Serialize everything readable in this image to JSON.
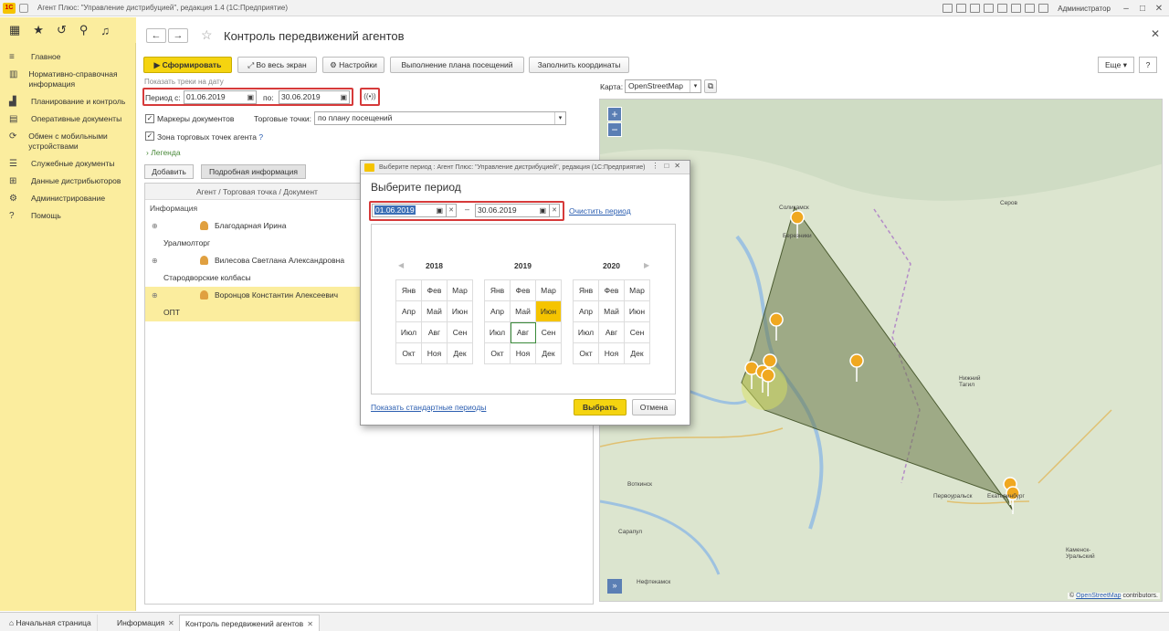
{
  "window": {
    "title": "Агент Плюс: \"Управление дистрибуцией\", редакция 1.4 (1С:Предприятие)",
    "user": "Администратор"
  },
  "sidebar": {
    "items": [
      {
        "label": "Главное",
        "icon": "menu-icon"
      },
      {
        "label": "Нормативно-справочная информация",
        "icon": "grid-icon"
      },
      {
        "label": "Планирование и контроль",
        "icon": "chart-icon"
      },
      {
        "label": "Оперативные документы",
        "icon": "document-icon"
      },
      {
        "label": "Обмен с мобильными устройствами",
        "icon": "sync-icon"
      },
      {
        "label": "Служебные документы",
        "icon": "list-icon"
      },
      {
        "label": "Данные дистрибьюторов",
        "icon": "table-icon"
      },
      {
        "label": "Администрирование",
        "icon": "gear-icon"
      },
      {
        "label": "Помощь",
        "icon": "help-icon"
      }
    ]
  },
  "page": {
    "title": "Контроль передвижений агентов"
  },
  "toolbar": {
    "generate": "Сформировать",
    "fullscreen": "Во весь экран",
    "settings": "Настройки",
    "plan": "Выполнение плана посещений",
    "fill_coords": "Заполнить координаты",
    "more": "Еще",
    "help": "?"
  },
  "filters": {
    "hint": "Показать треки на дату",
    "period_from_label": "Период с:",
    "period_from": "01.06.2019",
    "period_to_label": "по:",
    "period_to": "30.06.2019",
    "doc_markers": "Маркеры документов",
    "trade_points_label": "Торговые точки:",
    "trade_points_value": "по плану посещений",
    "zone_label": "Зона торговых точек агента",
    "zone_help": "?",
    "legend": "Легенда"
  },
  "tabs": {
    "add": "Добавить",
    "details": "Подробная информация"
  },
  "grid": {
    "header": "Агент / Торговая точка / Документ",
    "subheader": "Информация",
    "rows": [
      {
        "agent": "Благодарная Ирина",
        "org": "Уралмолторг"
      },
      {
        "agent": "Вилесова Светлана Александровна",
        "org": "Стародворские колбасы"
      },
      {
        "agent": "Воронцов Константин Алексеевич",
        "org": "ОПТ"
      }
    ]
  },
  "map": {
    "label": "Карта:",
    "provider": "OpenStreetMap",
    "zoom_in": "+",
    "zoom_out": "−",
    "expand": "»",
    "attribution_link": "OpenStreetMap",
    "attribution_text": "contributors.",
    "attribution_prefix": "©",
    "cities": [
      {
        "name": "Соликамск"
      },
      {
        "name": "Березники"
      },
      {
        "name": "Серов"
      },
      {
        "name": "Нижний Тагил"
      },
      {
        "name": "Первоуральск"
      },
      {
        "name": "Екатеринбург"
      },
      {
        "name": "Воткинск"
      },
      {
        "name": "Сарапул"
      },
      {
        "name": "Нефтекамск"
      },
      {
        "name": "Каменск-Уральский"
      }
    ]
  },
  "dialog": {
    "bar_title": "Выберите период : Агент Плюс: \"Управление дистрибуцией\", редакция (1С:Предприятие)",
    "title": "Выберите период",
    "date_from": "01.06.2019",
    "date_to": "30.06.2019",
    "dash": "–",
    "clear": "Очистить период",
    "years": [
      "2018",
      "2019",
      "2020"
    ],
    "months": [
      "Янв",
      "Фев",
      "Мар",
      "Апр",
      "Май",
      "Июн",
      "Июл",
      "Авг",
      "Сен",
      "Окт",
      "Ноя",
      "Дек"
    ],
    "show_standard": "Показать стандартные периоды",
    "select": "Выбрать",
    "cancel": "Отмена"
  },
  "bottom_tabs": [
    {
      "label": "Начальная страница"
    },
    {
      "label": "Информация"
    },
    {
      "label": "Контроль передвижений агентов"
    }
  ]
}
